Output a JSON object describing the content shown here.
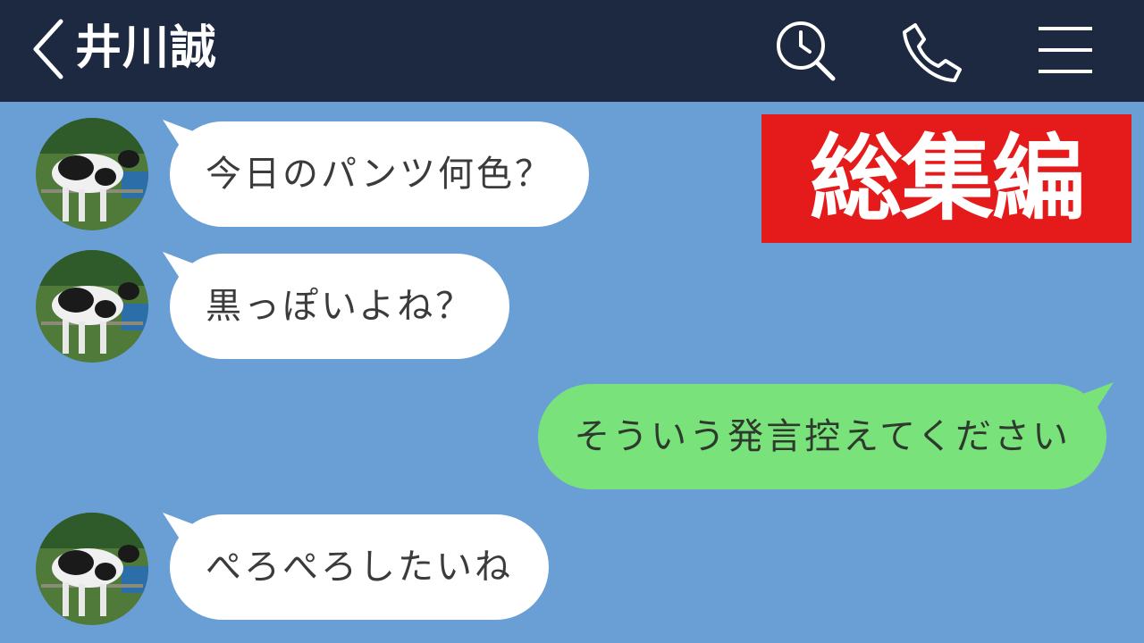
{
  "header": {
    "contact_name": "井川誠",
    "icons": [
      "back-chevron-icon",
      "search-clock-icon",
      "phone-icon",
      "menu-icon"
    ]
  },
  "overlay_banner": {
    "text": "総集編",
    "background": "#e51a1a"
  },
  "messages": [
    {
      "direction": "incoming",
      "text": "今日のパンツ何色？"
    },
    {
      "direction": "incoming",
      "text": "黒っぽいよね？"
    },
    {
      "direction": "outgoing",
      "text": "そういう発言控えてください"
    },
    {
      "direction": "incoming",
      "text": "ぺろぺろしたいね"
    }
  ],
  "colors": {
    "header_bg": "#1d2841",
    "chat_bg": "#6a9fd6",
    "incoming_bubble": "#ffffff",
    "outgoing_bubble": "#79e27a"
  }
}
